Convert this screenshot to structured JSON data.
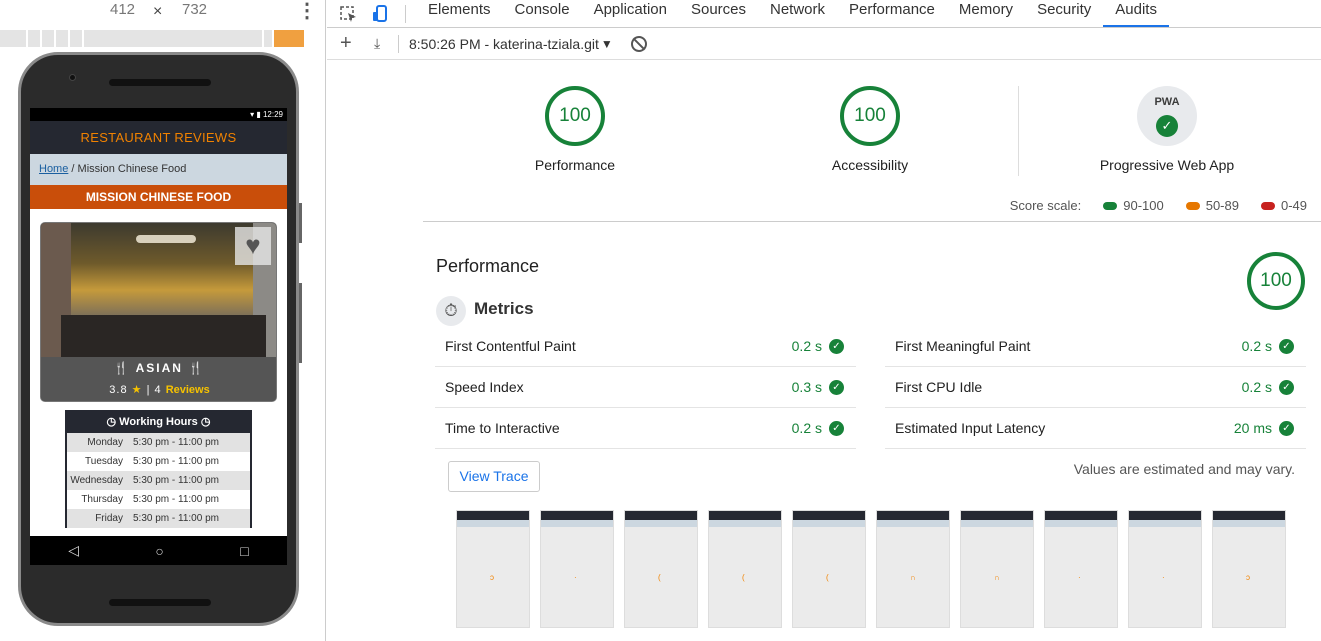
{
  "device": {
    "width": "412",
    "times": "×",
    "height": "732",
    "more": "⋮"
  },
  "mobile": {
    "status_time": "12:29",
    "app_title": "RESTAURANT REVIEWS",
    "crumb_home": "Home",
    "crumb_sep": "/",
    "crumb_current": "Mission Chinese Food",
    "restaurant_name": "MISSION CHINESE FOOD",
    "cuisine": "ASIAN",
    "rating_value": "3.8",
    "rating_sep": "|",
    "review_count": "4",
    "reviews_label": "Reviews",
    "hours_title": "Working Hours",
    "hours": [
      {
        "day": "Monday",
        "time": "5:30 pm - 11:00 pm"
      },
      {
        "day": "Tuesday",
        "time": "5:30 pm - 11:00 pm"
      },
      {
        "day": "Wednesday",
        "time": "5:30 pm - 11:00 pm"
      },
      {
        "day": "Thursday",
        "time": "5:30 pm - 11:00 pm"
      },
      {
        "day": "Friday",
        "time": "5:30 pm - 11:00 pm"
      }
    ]
  },
  "devtools": {
    "tabs": [
      "Elements",
      "Console",
      "Application",
      "Sources",
      "Network",
      "Performance",
      "Memory",
      "Security",
      "Audits"
    ],
    "active_tab": "Audits",
    "report_label": "8:50:26 PM - katerina-tziala.git"
  },
  "audits": {
    "categories": [
      {
        "name": "Performance",
        "score": "100"
      },
      {
        "name": "Accessibility",
        "score": "100"
      },
      {
        "name": "Progressive Web App",
        "badge": "PWA"
      }
    ],
    "score_scale_label": "Score scale:",
    "scale": [
      {
        "range": "90-100",
        "color": "#178239"
      },
      {
        "range": "50-89",
        "color": "#e67700"
      },
      {
        "range": "0-49",
        "color": "#c7221f"
      }
    ],
    "section_title": "Performance",
    "section_score": "100",
    "metrics_title": "Metrics",
    "metrics": [
      {
        "name": "First Contentful Paint",
        "value": "0.2 s"
      },
      {
        "name": "First Meaningful Paint",
        "value": "0.2 s"
      },
      {
        "name": "Speed Index",
        "value": "0.3 s"
      },
      {
        "name": "First CPU Idle",
        "value": "0.2 s"
      },
      {
        "name": "Time to Interactive",
        "value": "0.2 s"
      },
      {
        "name": "Estimated Input Latency",
        "value": "20 ms"
      }
    ],
    "view_trace": "View Trace",
    "estimate_note": "Values are estimated and may vary."
  },
  "colors": {
    "pass": "#178239",
    "accent": "#1a73e8",
    "brand": "#f18200"
  }
}
